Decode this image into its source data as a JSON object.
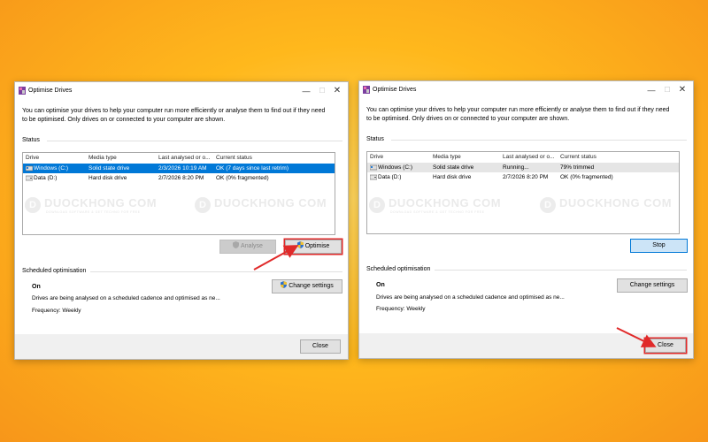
{
  "windows": [
    {
      "title": "Optimise Drives",
      "description": "You can optimise your drives to help your computer run more efficiently or analyse them to find out if they need to be optimised. Only drives on or connected to your computer are shown.",
      "status_label": "Status",
      "columns": [
        "Drive",
        "Media type",
        "Last analysed or o...",
        "Current status"
      ],
      "rows": [
        {
          "drive": "Windows (C:)",
          "media": "Solid state drive",
          "last": "2/3/2026 10:19 AM",
          "status": "OK (7 days since last retrim)"
        },
        {
          "drive": "Data (D:)",
          "media": "Hard disk drive",
          "last": "2/7/2026 8:20 PM",
          "status": "OK (0% fragmented)"
        }
      ],
      "analyse_label": "Analyse",
      "optimise_label": "Optimise",
      "scheduled_label": "Scheduled optimisation",
      "sched_on": "On",
      "sched_desc": "Drives are being analysed on a scheduled cadence and optimised as ne...",
      "frequency": "Frequency: Weekly",
      "change_settings_label": "Change settings",
      "close_label": "Close"
    },
    {
      "title": "Optimise Drives",
      "description": "You can optimise your drives to help your computer run more efficiently or analyse them to find out if they need to be optimised. Only drives on or connected to your computer are shown.",
      "status_label": "Status",
      "columns": [
        "Drive",
        "Media type",
        "Last analysed or o...",
        "Current status"
      ],
      "rows": [
        {
          "drive": "Windows (C:)",
          "media": "Solid state drive",
          "last": "Running...",
          "status": "79% trimmed"
        },
        {
          "drive": "Data (D:)",
          "media": "Hard disk drive",
          "last": "2/7/2026 8:20 PM",
          "status": "OK (0% fragmented)"
        }
      ],
      "stop_label": "Stop",
      "scheduled_label": "Scheduled optimisation",
      "sched_on": "On",
      "sched_desc": "Drives are being analysed on a scheduled cadence and optimised as ne...",
      "frequency": "Frequency: Weekly",
      "change_settings_label": "Change settings",
      "close_label": "Close"
    }
  ],
  "watermark": {
    "text": "DUOCKHONG COM",
    "sub": "DOWNLOAD SOFTWARE & GET TECHNO FOR FREE",
    "logo": "D"
  },
  "colors": {
    "selection": "#0078d7",
    "annotation": "#e02a2a",
    "background": "#ffb81c"
  }
}
